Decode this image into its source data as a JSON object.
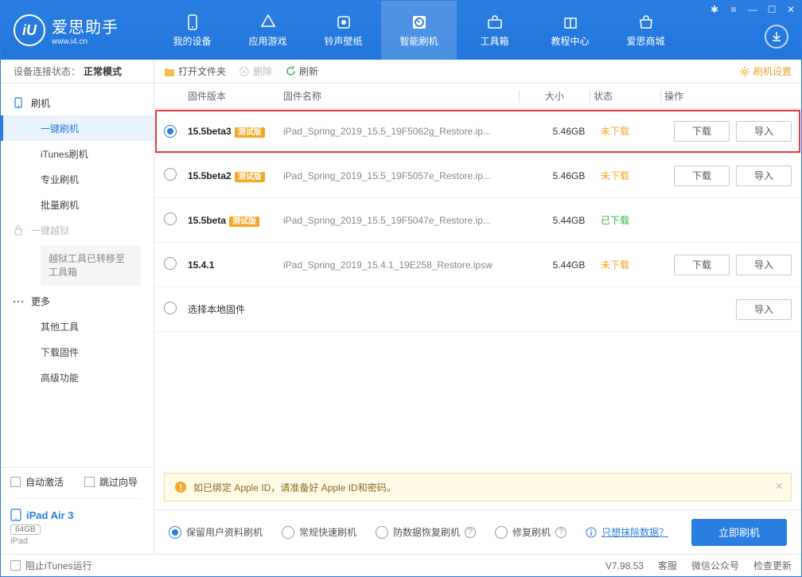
{
  "header": {
    "logo_initials": "iU",
    "title": "爱思助手",
    "subtitle": "www.i4.cn",
    "nav": [
      {
        "id": "my-device",
        "label": "我的设备"
      },
      {
        "id": "apps-games",
        "label": "应用游戏"
      },
      {
        "id": "ringtones",
        "label": "铃声壁纸"
      },
      {
        "id": "smart-flash",
        "label": "智能刷机"
      },
      {
        "id": "toolbox",
        "label": "工具箱"
      },
      {
        "id": "tutorials",
        "label": "教程中心"
      },
      {
        "id": "store",
        "label": "爱思商城"
      }
    ],
    "active_nav": "smart-flash"
  },
  "sidebar": {
    "conn_label": "设备连接状态：",
    "conn_value": "正常模式",
    "flash_header": "刷机",
    "items": [
      {
        "id": "one-key",
        "label": "一键刷机",
        "active": true
      },
      {
        "id": "itunes",
        "label": "iTunes刷机"
      },
      {
        "id": "pro",
        "label": "专业刷机"
      },
      {
        "id": "batch",
        "label": "批量刷机"
      }
    ],
    "jailbreak_header": "一键越狱",
    "jailbreak_note": "越狱工具已转移至工具箱",
    "more_header": "更多",
    "more_items": [
      {
        "id": "other-tools",
        "label": "其他工具"
      },
      {
        "id": "download-fw",
        "label": "下载固件"
      },
      {
        "id": "advanced",
        "label": "高级功能"
      }
    ],
    "auto_activate": "自动激活",
    "skip_guide": "跳过向导",
    "device_name": "iPad Air 3",
    "storage": "64GB",
    "device_type": "iPad"
  },
  "toolbar": {
    "open_folder": "打开文件夹",
    "delete": "删除",
    "refresh": "刷新",
    "settings": "刷机设置"
  },
  "columns": {
    "version": "固件版本",
    "name": "固件名称",
    "size": "大小",
    "status": "状态",
    "actions": "操作"
  },
  "actions": {
    "download": "下载",
    "import": "导入"
  },
  "beta_tag": "测试版",
  "firmware": [
    {
      "version": "15.5beta3",
      "beta": true,
      "name": "iPad_Spring_2019_15.5_19F5062g_Restore.ip...",
      "size": "5.46GB",
      "status": "未下载",
      "status_class": "pending",
      "selected": true,
      "highlight": true,
      "show_download": true
    },
    {
      "version": "15.5beta2",
      "beta": true,
      "name": "iPad_Spring_2019_15.5_19F5057e_Restore.ip...",
      "size": "5.46GB",
      "status": "未下载",
      "status_class": "pending",
      "selected": false,
      "show_download": true
    },
    {
      "version": "15.5beta",
      "beta": true,
      "name": "iPad_Spring_2019_15.5_19F5047e_Restore.ip...",
      "size": "5.44GB",
      "status": "已下载",
      "status_class": "done",
      "selected": false,
      "show_download": false
    },
    {
      "version": "15.4.1",
      "beta": false,
      "name": "iPad_Spring_2019_15.4.1_19E258_Restore.ipsw",
      "size": "5.44GB",
      "status": "未下载",
      "status_class": "pending",
      "selected": false,
      "show_download": true
    }
  ],
  "local_fw": "选择本地固件",
  "notice": "如已绑定 Apple ID，请准备好 Apple ID和密码。",
  "options": {
    "keep_data": "保留用户资料刷机",
    "normal": "常规快速刷机",
    "anti_data": "防数据恢复刷机",
    "repair": "修复刷机",
    "erase_link": "只想抹除数据？",
    "flash_now": "立即刷机"
  },
  "footer": {
    "block_itunes": "阻止iTunes运行",
    "version": "V7.98.53",
    "support": "客服",
    "wechat": "微信公众号",
    "check_update": "检查更新"
  }
}
